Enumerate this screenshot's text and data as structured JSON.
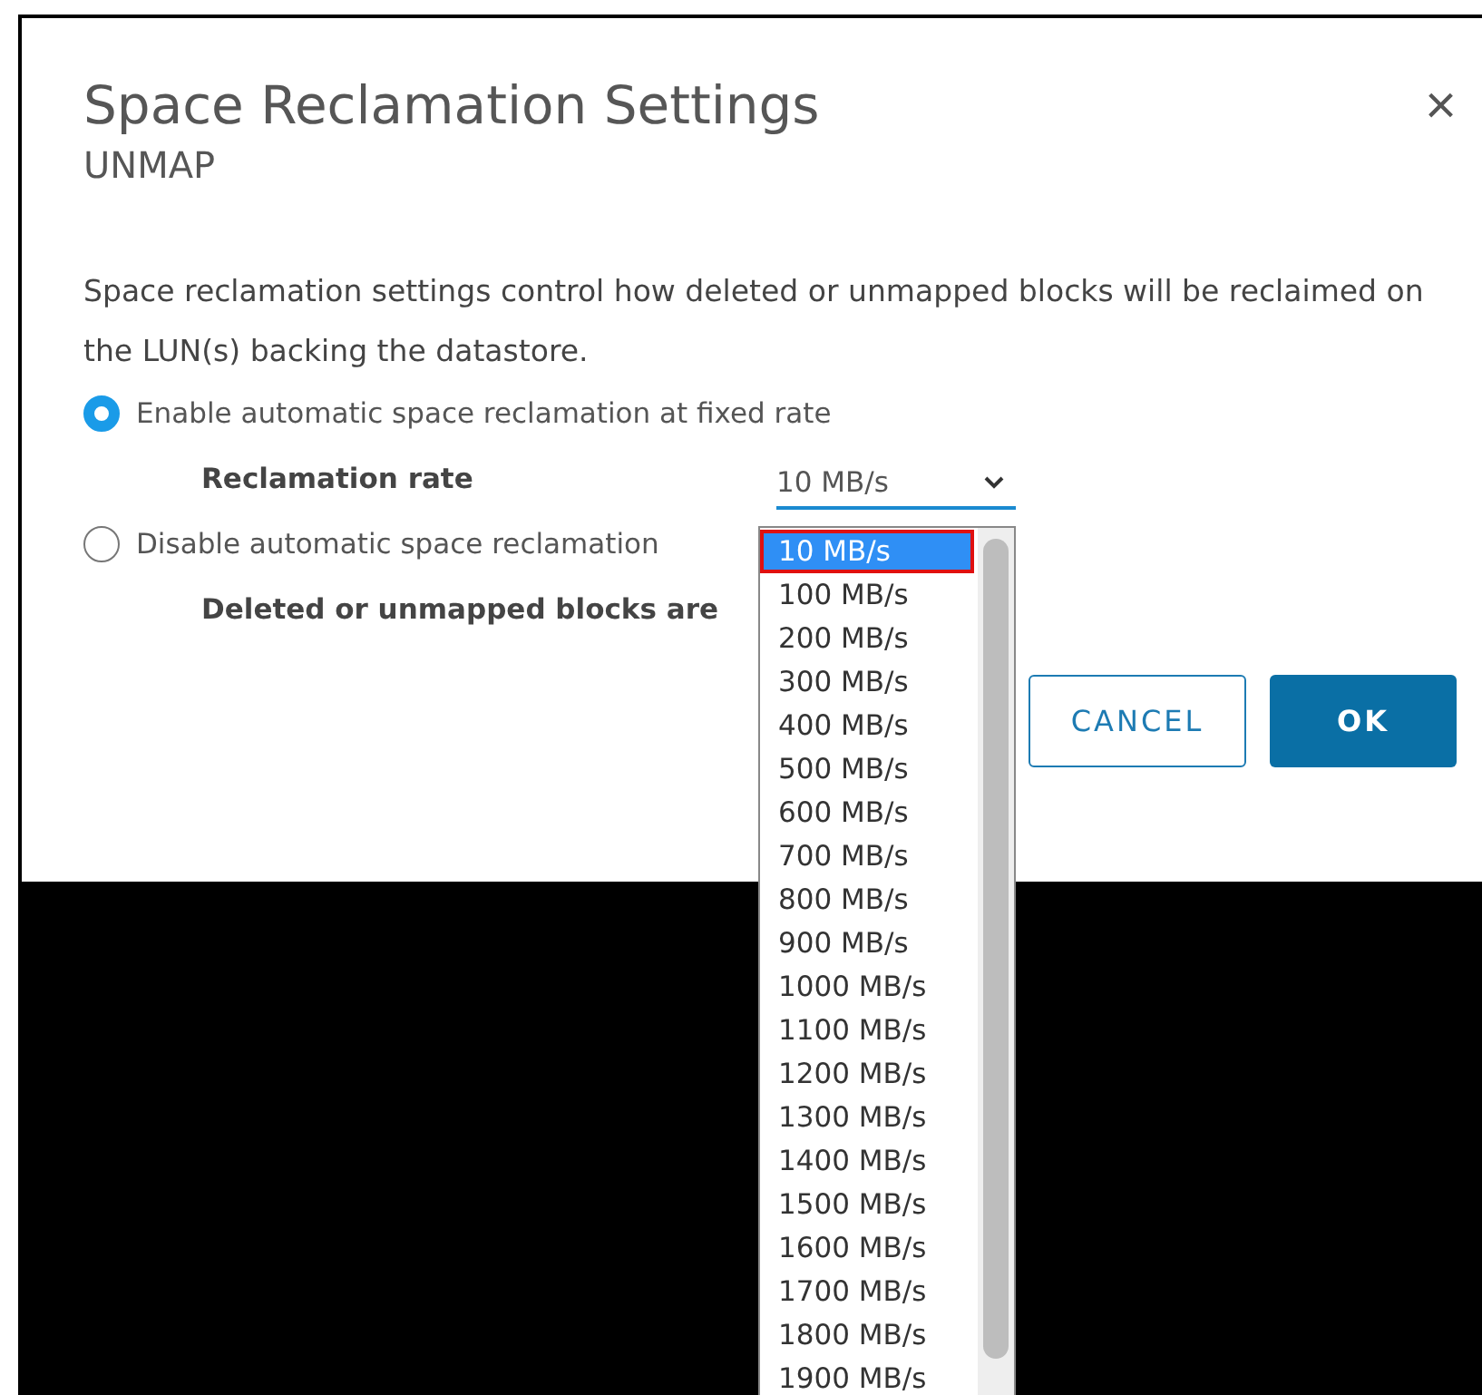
{
  "dialog": {
    "title": "Space Reclamation Settings",
    "subtitle": "UNMAP",
    "close": "×",
    "description": "Space reclamation settings control how deleted or unmapped blocks will be reclaimed on the LUN(s) backing the datastore.",
    "options": [
      {
        "kind": "rate",
        "label": "Enable automatic space reclamation at fixed rate",
        "selected": true,
        "field_label": "Reclamation rate",
        "value": "10 MB/s"
      },
      {
        "kind": "note",
        "label": "Disable automatic space reclamation",
        "selected": false,
        "note": "Deleted or unmapped blocks are"
      }
    ],
    "buttons": [
      {
        "kind": "secondary",
        "label": "CANCEL"
      },
      {
        "kind": "primary",
        "label": "OK"
      }
    ]
  },
  "dropdown": {
    "items": [
      {
        "label": "10 MB/s",
        "selected": true
      },
      {
        "label": "100 MB/s",
        "selected": false
      },
      {
        "label": "200 MB/s",
        "selected": false
      },
      {
        "label": "300 MB/s",
        "selected": false
      },
      {
        "label": "400 MB/s",
        "selected": false
      },
      {
        "label": "500 MB/s",
        "selected": false
      },
      {
        "label": "600 MB/s",
        "selected": false
      },
      {
        "label": "700 MB/s",
        "selected": false
      },
      {
        "label": "800 MB/s",
        "selected": false
      },
      {
        "label": "900 MB/s",
        "selected": false
      },
      {
        "label": "1000 MB/s",
        "selected": false
      },
      {
        "label": "1100 MB/s",
        "selected": false
      },
      {
        "label": "1200 MB/s",
        "selected": false
      },
      {
        "label": "1300 MB/s",
        "selected": false
      },
      {
        "label": "1400 MB/s",
        "selected": false
      },
      {
        "label": "1500 MB/s",
        "selected": false
      },
      {
        "label": "1600 MB/s",
        "selected": false
      },
      {
        "label": "1700 MB/s",
        "selected": false
      },
      {
        "label": "1800 MB/s",
        "selected": false
      },
      {
        "label": "1900 MB/s",
        "selected": false
      }
    ]
  }
}
